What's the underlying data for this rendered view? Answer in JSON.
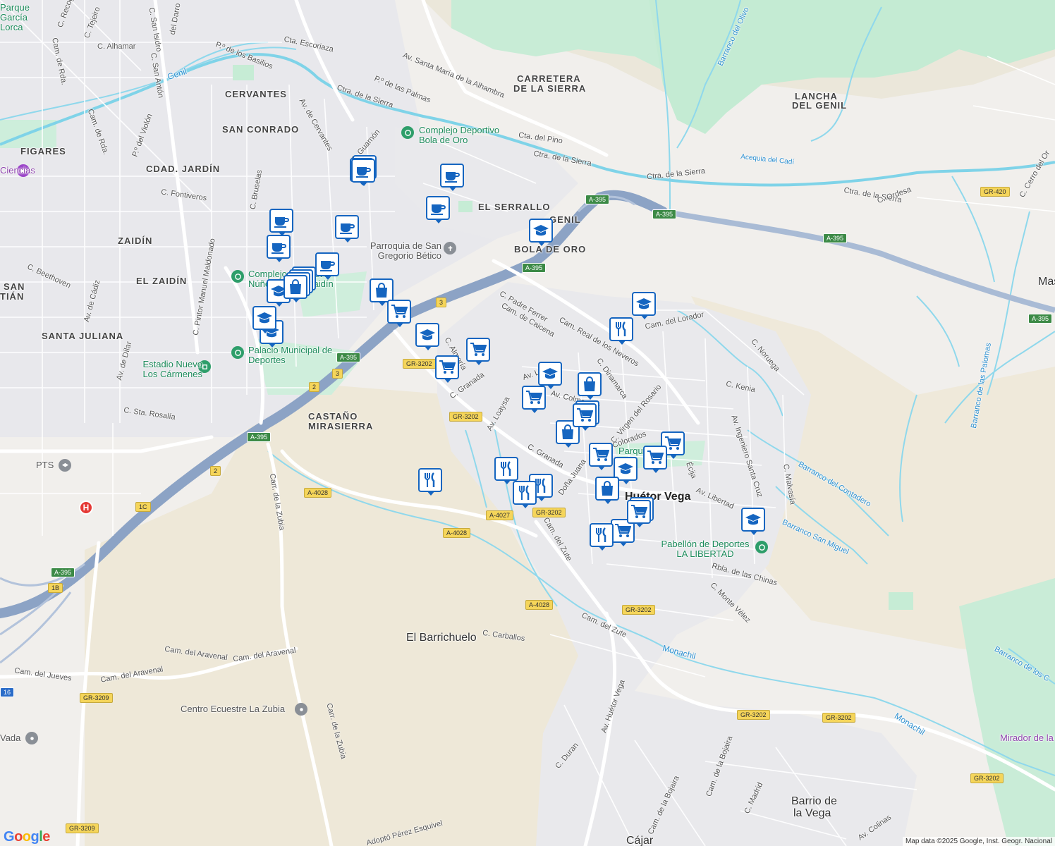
{
  "map": {
    "attribution": "Map data ©2025 Google, Inst. Geogr. Nacional",
    "logo": "Google",
    "colors": {
      "land": "#f1efec",
      "urban": "#e7e7ea",
      "park": "#c5ecd6",
      "rural": "#eee8d8",
      "highway": "#8ca3c5",
      "river": "#7fd3e8",
      "pin_border": "#1565c0"
    }
  },
  "labels": {
    "neighborhoods": [
      "CERVANTES",
      "SAN CONRADO",
      "FIGARES",
      "CDAD. JARDÍN",
      "ZAIDÍN",
      "EL ZAIDÍN",
      "SANTA JULIANA",
      "SAN",
      "TIÁN",
      "CASTAÑO",
      "MIRASIERRA",
      "CARRETERA",
      "DE LA SIERRA",
      "LANCHA",
      "DEL GENIL",
      "EL SERRALLO",
      "GENIL",
      "BOLA DE ORO"
    ],
    "towns": [
      "Huétor Vega",
      "El Barrichuelo",
      "Barrio de",
      "la Vega",
      "Cájar",
      "Mas"
    ],
    "streets": [
      "Cam. de Rda.",
      "C. Alhamar",
      "Cta. Escoriaza",
      "P.º de los Basilios",
      "C. San Isidro",
      "C. San Antón",
      "C. Tejeiro",
      "C. Recog",
      "del Darro",
      "Av. Santa María de la Alhambra",
      "P.º de las Palmas",
      "Ctra. de la Sierra",
      "Cta. del Pino",
      "Ctra. de la Sierra",
      "Ctra. de la Sierra",
      "Ctra. de la Sierra",
      "C. Ordesa",
      "C. Cerro del Or",
      "Av. de Cervantes",
      "C. Guarnón",
      "P.º del Violón",
      "Cam. de Rda.",
      "C. Fontiveros",
      "C. Bruselas",
      "C. Beethoven",
      "Av. de Cádiz",
      "C. Pintor Manuel Maldonado",
      "Av. de Dílar",
      "C. Sta. Rosalía",
      "C. Padre Ferrer",
      "Cam. de Caicena",
      "Cam. Real de los Neveros",
      "Cam. del Lorador",
      "C. Noruega",
      "C. Kenia",
      "Av. Ingeniero Santa Cruz",
      "C. Malvasía",
      "C. Dinamarca",
      "C. Virgen del Rosario",
      "Av. Colorados",
      "Écija",
      "Av. Libertad",
      "Rbla. de las Chinas",
      "C. Monte Vélez",
      "C. Almería",
      "C. Granada",
      "Av. Loaysa",
      "C. Granada",
      "Doña Juana",
      "Cam. del Zute",
      "Cam. del Zute",
      "C. Carballos",
      "Cam. del Jueves",
      "Cam. del Aravenal",
      "Cam. del Aravenal",
      "Cam. del Aravenal",
      "Carr. de la Zubia",
      "Carr. de la Zubia",
      "C. Duran",
      "Av. Huétor Vega",
      "Cam. de la Bojaira",
      "Cam. de la Bojaira",
      "C. Madrid",
      "Av. Colinas",
      "Adoptó Pérez Esquivel",
      "Acequia del Cadí",
      "Barranco del Olivo",
      "Barranco de las Palomas",
      "Barranco del Contadero",
      "Barranco San Miguel",
      "Barranco de los C",
      "Av. Loaysa",
      "Av. Colmenero"
    ],
    "water": [
      "Genil",
      "Monachil",
      "Monachil"
    ],
    "pois": [
      {
        "name": "Complejo Deportivo Bola de Oro",
        "kind": "sports",
        "color": "green"
      },
      {
        "name": "Parroquia de San Gregorio Bético",
        "kind": "church",
        "color": "grey"
      },
      {
        "name": "Complejo Deportivo Núñez Blanca Zaidín",
        "kind": "sports",
        "color": "green"
      },
      {
        "name": "Palacio Municipal de Deportes",
        "kind": "sports",
        "color": "green"
      },
      {
        "name": "Estadio Nuevo Los Cármenes",
        "kind": "stadium",
        "color": "green"
      },
      {
        "name": "Pabellón de Deportes LA LIBERTAD",
        "kind": "sports",
        "color": "green"
      },
      {
        "name": "Centro Ecuestre La Zubia",
        "kind": "place",
        "color": "grey"
      },
      {
        "name": "PTS",
        "kind": "school",
        "color": "grey"
      },
      {
        "name": "Parque",
        "kind": "park",
        "color": "green"
      },
      {
        "name": "Parque García Lorca",
        "kind": "park",
        "color": "green"
      },
      {
        "name": "Mirador de la",
        "kind": "viewpoint",
        "color": "purple"
      },
      {
        "name": "Ciencias",
        "kind": "museum",
        "color": "purple"
      },
      {
        "name": "Vada",
        "kind": "place",
        "color": "grey"
      }
    ],
    "road_shields": [
      "A-395",
      "A-395",
      "A-395",
      "A-395",
      "A-395",
      "A-395",
      "A-395",
      "GR-3202",
      "GR-3202",
      "GR-3202",
      "GR-3202",
      "GR-3202",
      "GR-3202",
      "A-4028",
      "A-4028",
      "A-4028",
      "A-4027",
      "GR-3209",
      "GR-3209",
      "GR-420",
      "3",
      "3",
      "2",
      "2",
      "1C",
      "1B",
      "16"
    ]
  },
  "markers": [
    {
      "icon": "coffee-icon",
      "count": 2
    },
    {
      "icon": "coffee-icon",
      "count": 1
    },
    {
      "icon": "coffee-icon",
      "count": 1
    },
    {
      "icon": "coffee-icon",
      "count": 1
    },
    {
      "icon": "coffee-icon",
      "count": 1
    },
    {
      "icon": "coffee-icon",
      "count": 1
    },
    {
      "icon": "coffee-icon",
      "count": 1
    },
    {
      "icon": "coffee-icon",
      "count": 1
    },
    {
      "icon": "school-icon",
      "count": 1
    },
    {
      "icon": "school-icon",
      "count": 1
    },
    {
      "icon": "school-icon",
      "count": 1
    },
    {
      "icon": "school-icon",
      "count": 1
    },
    {
      "icon": "school-icon",
      "count": 1
    },
    {
      "icon": "school-icon",
      "count": 1
    },
    {
      "icon": "school-icon",
      "count": 1
    },
    {
      "icon": "school-icon",
      "count": 1
    },
    {
      "icon": "school-icon",
      "count": 1
    },
    {
      "icon": "shopping-bag-icon",
      "count": 4
    },
    {
      "icon": "shopping-bag-icon",
      "count": 1
    },
    {
      "icon": "shopping-bag-icon",
      "count": 1
    },
    {
      "icon": "shopping-bag-icon",
      "count": 1
    },
    {
      "icon": "shopping-bag-icon",
      "count": 1
    },
    {
      "icon": "shopping-cart-icon",
      "count": 1
    },
    {
      "icon": "shopping-cart-icon",
      "count": 1
    },
    {
      "icon": "shopping-cart-icon",
      "count": 1
    },
    {
      "icon": "shopping-cart-icon",
      "count": 1
    },
    {
      "icon": "shopping-cart-icon",
      "count": 1
    },
    {
      "icon": "shopping-cart-icon",
      "count": 2
    },
    {
      "icon": "shopping-cart-icon",
      "count": 1
    },
    {
      "icon": "shopping-cart-icon",
      "count": 1
    },
    {
      "icon": "shopping-cart-icon",
      "count": 1
    },
    {
      "icon": "shopping-cart-icon",
      "count": 2
    },
    {
      "icon": "restaurant-icon",
      "count": 1
    },
    {
      "icon": "restaurant-icon",
      "count": 1
    },
    {
      "icon": "restaurant-icon",
      "count": 1
    },
    {
      "icon": "restaurant-icon",
      "count": 1
    },
    {
      "icon": "restaurant-icon",
      "count": 1
    },
    {
      "icon": "restaurant-icon",
      "count": 1
    }
  ]
}
